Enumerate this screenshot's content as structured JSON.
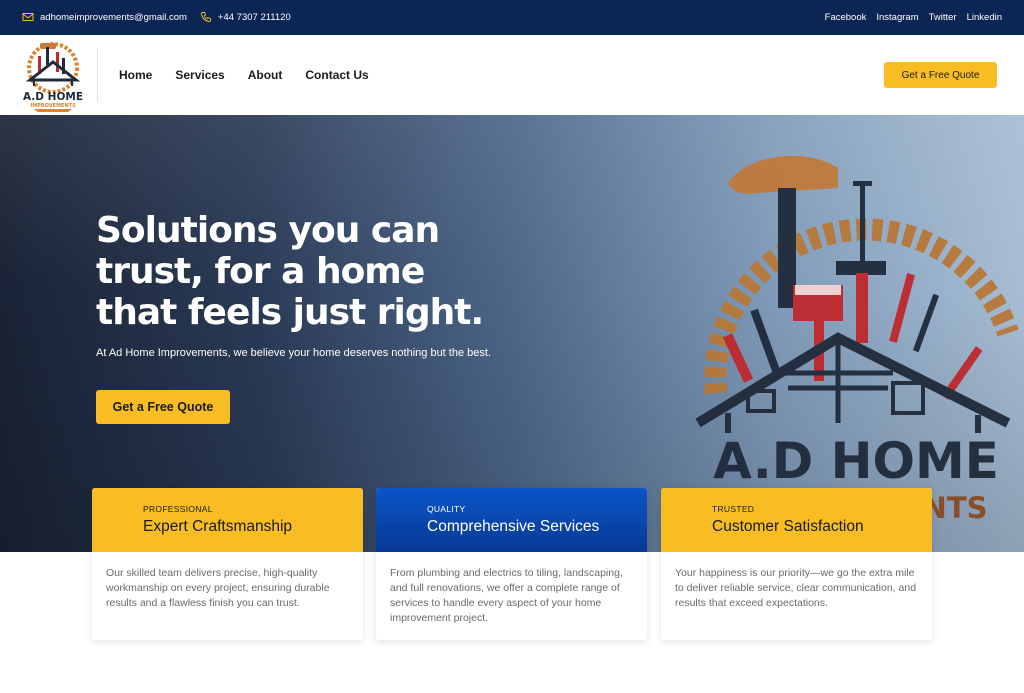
{
  "topbar": {
    "email": "adhomeimprovements@gmail.com",
    "phone": "+44 7307 211120",
    "social": [
      "Facebook",
      "Instagram",
      "Twitter",
      "Linkedin"
    ]
  },
  "header": {
    "logo_text": [
      "A.D HOME",
      "IMPROVEMENTS"
    ],
    "nav": [
      "Home",
      "Services",
      "About",
      "Contact Us"
    ],
    "cta": "Get a Free Quote"
  },
  "hero": {
    "heading": "Solutions you can trust, for a home that feels just right.",
    "subtext": "At Ad Home Improvements, we believe your home deserves nothing but the best.",
    "cta": "Get a Free Quote",
    "watermark_text": [
      "A.D HOME",
      "IMPROVEMENTS"
    ]
  },
  "features": [
    {
      "tag": "PROFESSIONAL",
      "title": "Expert Craftsmanship",
      "body": "Our skilled team delivers precise, high-quality workmanship on every project, ensuring durable results and a flawless finish you can trust."
    },
    {
      "tag": "QUALITY",
      "title": "Comprehensive Services",
      "body": "From plumbing and electrics to tiling, landscaping, and full renovations, we offer a complete range of services to handle every aspect of your home improvement project."
    },
    {
      "tag": "TRUSTED",
      "title": "Customer Satisfaction",
      "body": "Your happiness is our priority—we go the extra mile to deliver reliable service, clear communication, and results that exceed expectations."
    }
  ],
  "colors": {
    "topbar": "#0b2554",
    "accent": "#f8bd23",
    "card_blue": "#0b55c8"
  }
}
